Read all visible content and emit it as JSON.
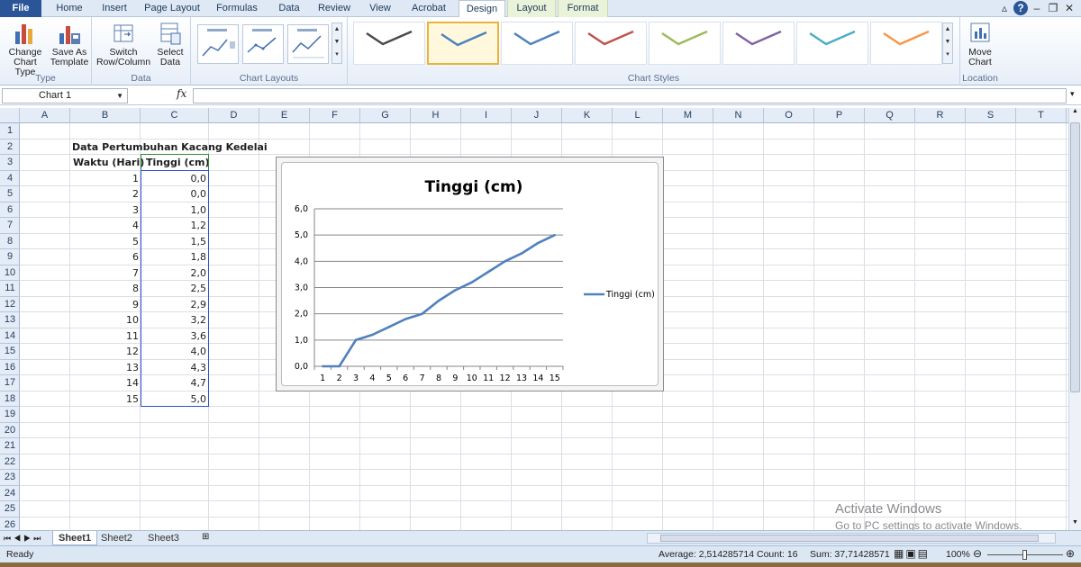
{
  "tabs": [
    "File",
    "Home",
    "Insert",
    "Page Layout",
    "Formulas",
    "Data",
    "Review",
    "View",
    "Acrobat",
    "Design",
    "Layout",
    "Format"
  ],
  "active_tab": "Design",
  "ribbon": {
    "groups": {
      "type": "Type",
      "data": "Data",
      "chart_layouts": "Chart Layouts",
      "chart_styles": "Chart Styles",
      "location": "Location"
    },
    "buttons": {
      "change_chart_type": [
        "Change",
        "Chart Type"
      ],
      "save_as_template": [
        "Save As",
        "Template"
      ],
      "switch_row_column": [
        "Switch",
        "Row/Column"
      ],
      "select_data": [
        "Select",
        "Data"
      ],
      "move_chart": [
        "Move",
        "Chart"
      ]
    },
    "style_colors": [
      "#4a4a4a",
      "#4f81bd",
      "#4f81bd",
      "#c0504d",
      "#9bbb59",
      "#8064a2",
      "#4bacc6",
      "#f79646"
    ],
    "selected_style_index": 1
  },
  "formula_bar": {
    "name_box": "Chart 1",
    "fx": "fx",
    "value": ""
  },
  "grid": {
    "columns": [
      "A",
      "B",
      "C",
      "D",
      "E",
      "F",
      "G",
      "H",
      "I",
      "J",
      "K",
      "L",
      "M",
      "N",
      "O",
      "P",
      "Q",
      "R",
      "S",
      "T"
    ],
    "rows": [
      "1",
      "2",
      "3",
      "4",
      "5",
      "6",
      "7",
      "8",
      "9",
      "10",
      "11",
      "12",
      "13",
      "14",
      "15",
      "16",
      "17",
      "18",
      "19",
      "20",
      "21",
      "22",
      "23",
      "24",
      "25",
      "26"
    ],
    "table_title": "Data Pertumbuhan Kacang Kedelai",
    "headers": [
      "Waktu (Hari)",
      "Tinggi (cm)"
    ],
    "data_rows": [
      [
        "1",
        "0,0"
      ],
      [
        "2",
        "0,0"
      ],
      [
        "3",
        "1,0"
      ],
      [
        "4",
        "1,2"
      ],
      [
        "5",
        "1,5"
      ],
      [
        "6",
        "1,8"
      ],
      [
        "7",
        "2,0"
      ],
      [
        "8",
        "2,5"
      ],
      [
        "9",
        "2,9"
      ],
      [
        "10",
        "3,2"
      ],
      [
        "11",
        "3,6"
      ],
      [
        "12",
        "4,0"
      ],
      [
        "13",
        "4,3"
      ],
      [
        "14",
        "4,7"
      ],
      [
        "15",
        "5,0"
      ]
    ]
  },
  "chart_data": {
    "type": "line",
    "title": "Tinggi (cm)",
    "x": [
      1,
      2,
      3,
      4,
      5,
      6,
      7,
      8,
      9,
      10,
      11,
      12,
      13,
      14,
      15
    ],
    "categories": [
      "1",
      "2",
      "3",
      "4",
      "5",
      "6",
      "7",
      "8",
      "9",
      "10",
      "11",
      "12",
      "13",
      "14",
      "15"
    ],
    "series": [
      {
        "name": "Tinggi (cm)",
        "values": [
          0.0,
          0.0,
          1.0,
          1.2,
          1.5,
          1.8,
          2.0,
          2.5,
          2.9,
          3.2,
          3.6,
          4.0,
          4.3,
          4.7,
          5.0
        ],
        "color": "#4f81bd"
      }
    ],
    "yticks": [
      "0,0",
      "1,0",
      "2,0",
      "3,0",
      "4,0",
      "5,0",
      "6,0"
    ],
    "ylim": [
      0,
      6
    ],
    "grid": true,
    "legend_position": "right"
  },
  "sheets": [
    "Sheet1",
    "Sheet2",
    "Sheet3"
  ],
  "active_sheet": "Sheet1",
  "status": {
    "ready": "Ready",
    "average": "Average: 2,514285714",
    "count": "Count: 16",
    "sum": "Sum: 37,71428571",
    "zoom": "100%"
  },
  "watermark": {
    "line1": "Activate Windows",
    "line2": "Go to PC settings to activate Windows."
  }
}
